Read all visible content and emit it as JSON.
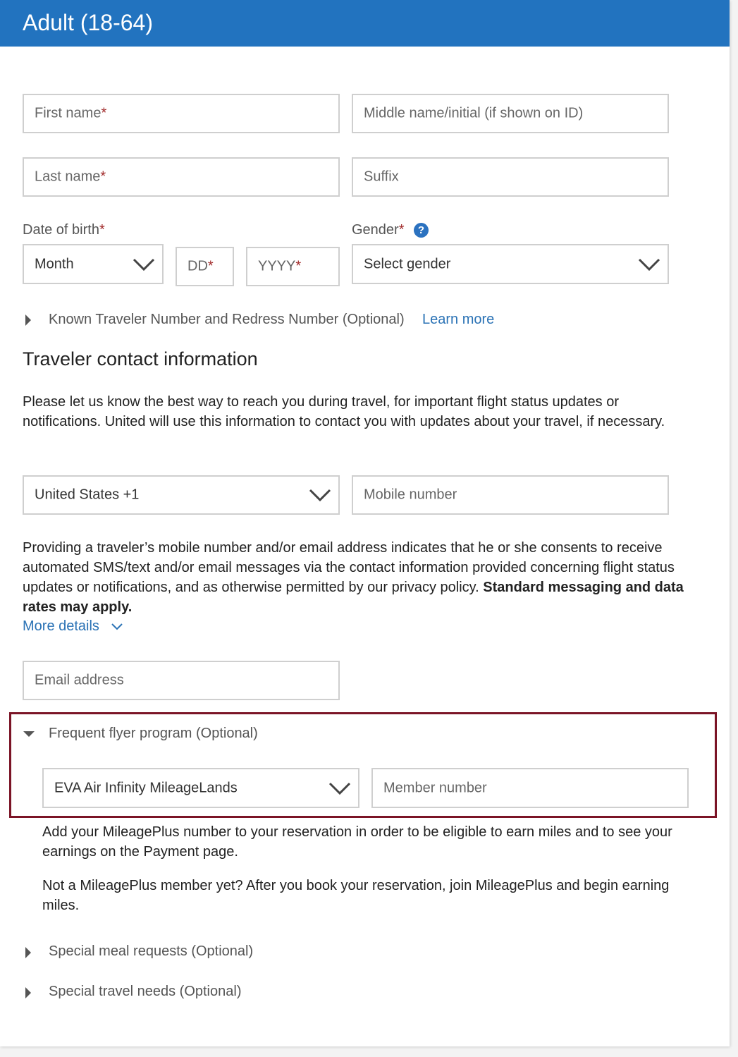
{
  "header": {
    "title": "Adult (18-64)"
  },
  "name_fields": {
    "first_name": "First name",
    "middle_name": "Middle name/initial (if shown on ID)",
    "last_name": "Last name",
    "suffix": "Suffix",
    "required_mark": "*"
  },
  "dob": {
    "label": "Date of birth",
    "month": "Month",
    "day": "DD",
    "year": "YYYY"
  },
  "gender": {
    "label": "Gender",
    "help_glyph": "?",
    "select": "Select gender"
  },
  "known_traveler": {
    "label": "Known Traveler Number and Redress Number (Optional)",
    "learn_more": "Learn more"
  },
  "contact": {
    "title": "Traveler contact information",
    "intro": "Please let us know the best way to reach you during travel, for important flight status updates or notifications. United will use this information to contact you with updates about your travel, if necessary.",
    "country_code": "United States +1",
    "mobile_placeholder": "Mobile number",
    "consent_text": "Providing a traveler’s mobile number and/or email address indicates that he or she consents to receive automated SMS/text and/or email messages via the contact information provided concerning flight status updates or notifications, and as otherwise permitted by our privacy policy.",
    "consent_bold": "Standard messaging and data rates may apply.",
    "more_details": "More details",
    "email_placeholder": "Email address"
  },
  "frequent_flyer": {
    "label": "Frequent flyer program (Optional)",
    "program": "EVA Air Infinity MileageLands",
    "member_placeholder": "Member number",
    "note1": "Add your MileagePlus number to your reservation in order to be eligible to earn miles and to see your earnings on the Payment page.",
    "note2": "Not a MileagePlus member yet? After you book your reservation, join MileagePlus and begin earning miles."
  },
  "special_meal": {
    "label": "Special meal requests (Optional)"
  },
  "special_needs": {
    "label": "Special travel needs (Optional)"
  },
  "colors": {
    "header_blue": "#2273bf",
    "highlight_border": "#7b1426",
    "required_red": "#a12a2a",
    "link_blue": "#2a72b5"
  }
}
